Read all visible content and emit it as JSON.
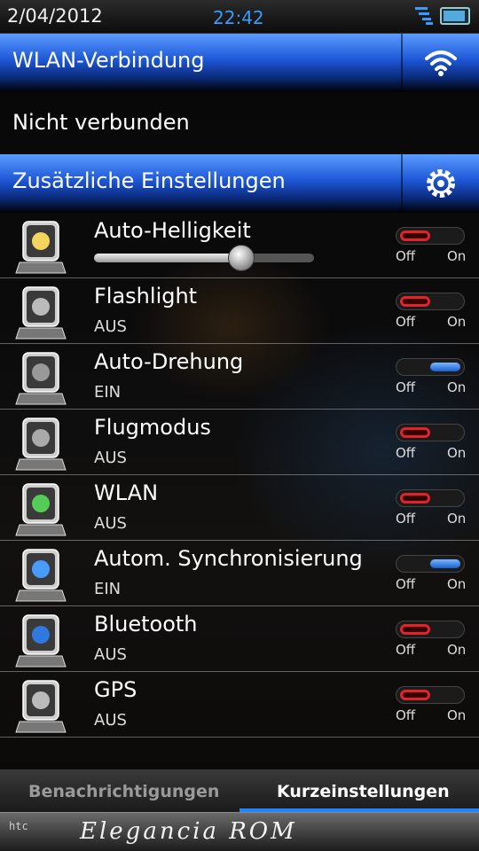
{
  "status_bar": {
    "date": "2/04/2012",
    "time": "22:42",
    "time_color": "#3a9bff"
  },
  "wlan_section": {
    "title": "WLAN-Verbindung",
    "icon": "wifi-icon",
    "status": "Nicht verbunden"
  },
  "extra_section": {
    "title": "Zusätzliche Einstellungen",
    "icon": "gear-icon"
  },
  "settings": [
    {
      "name": "Auto-Helligkeit",
      "icon": "bulb-icon",
      "state": "off",
      "slider_level": 0.67
    },
    {
      "name": "Flashlight",
      "status": "AUS",
      "icon": "flashlight-icon",
      "state": "off"
    },
    {
      "name": "Auto-Drehung",
      "status": "EIN",
      "icon": "rotation-icon",
      "state": "on"
    },
    {
      "name": "Flugmodus",
      "status": "AUS",
      "icon": "airplane-icon",
      "state": "off"
    },
    {
      "name": "WLAN",
      "status": "AUS",
      "icon": "wifi-icon",
      "state": "off"
    },
    {
      "name": "Autom. Synchronisierung",
      "status": "EIN",
      "icon": "sync-icon",
      "state": "on"
    },
    {
      "name": "Bluetooth",
      "status": "AUS",
      "icon": "bluetooth-icon",
      "state": "off"
    },
    {
      "name": "GPS",
      "status": "AUS",
      "icon": "gps-icon",
      "state": "off"
    }
  ],
  "toggle_labels": {
    "off": "Off",
    "on": "On"
  },
  "tabs": {
    "notifications": "Benachrichtigungen",
    "quick_settings": "Kurzeinstellungen",
    "accent": "#1e86ff"
  },
  "banner": {
    "logo": "htc",
    "text": "Elegancia ROM"
  }
}
